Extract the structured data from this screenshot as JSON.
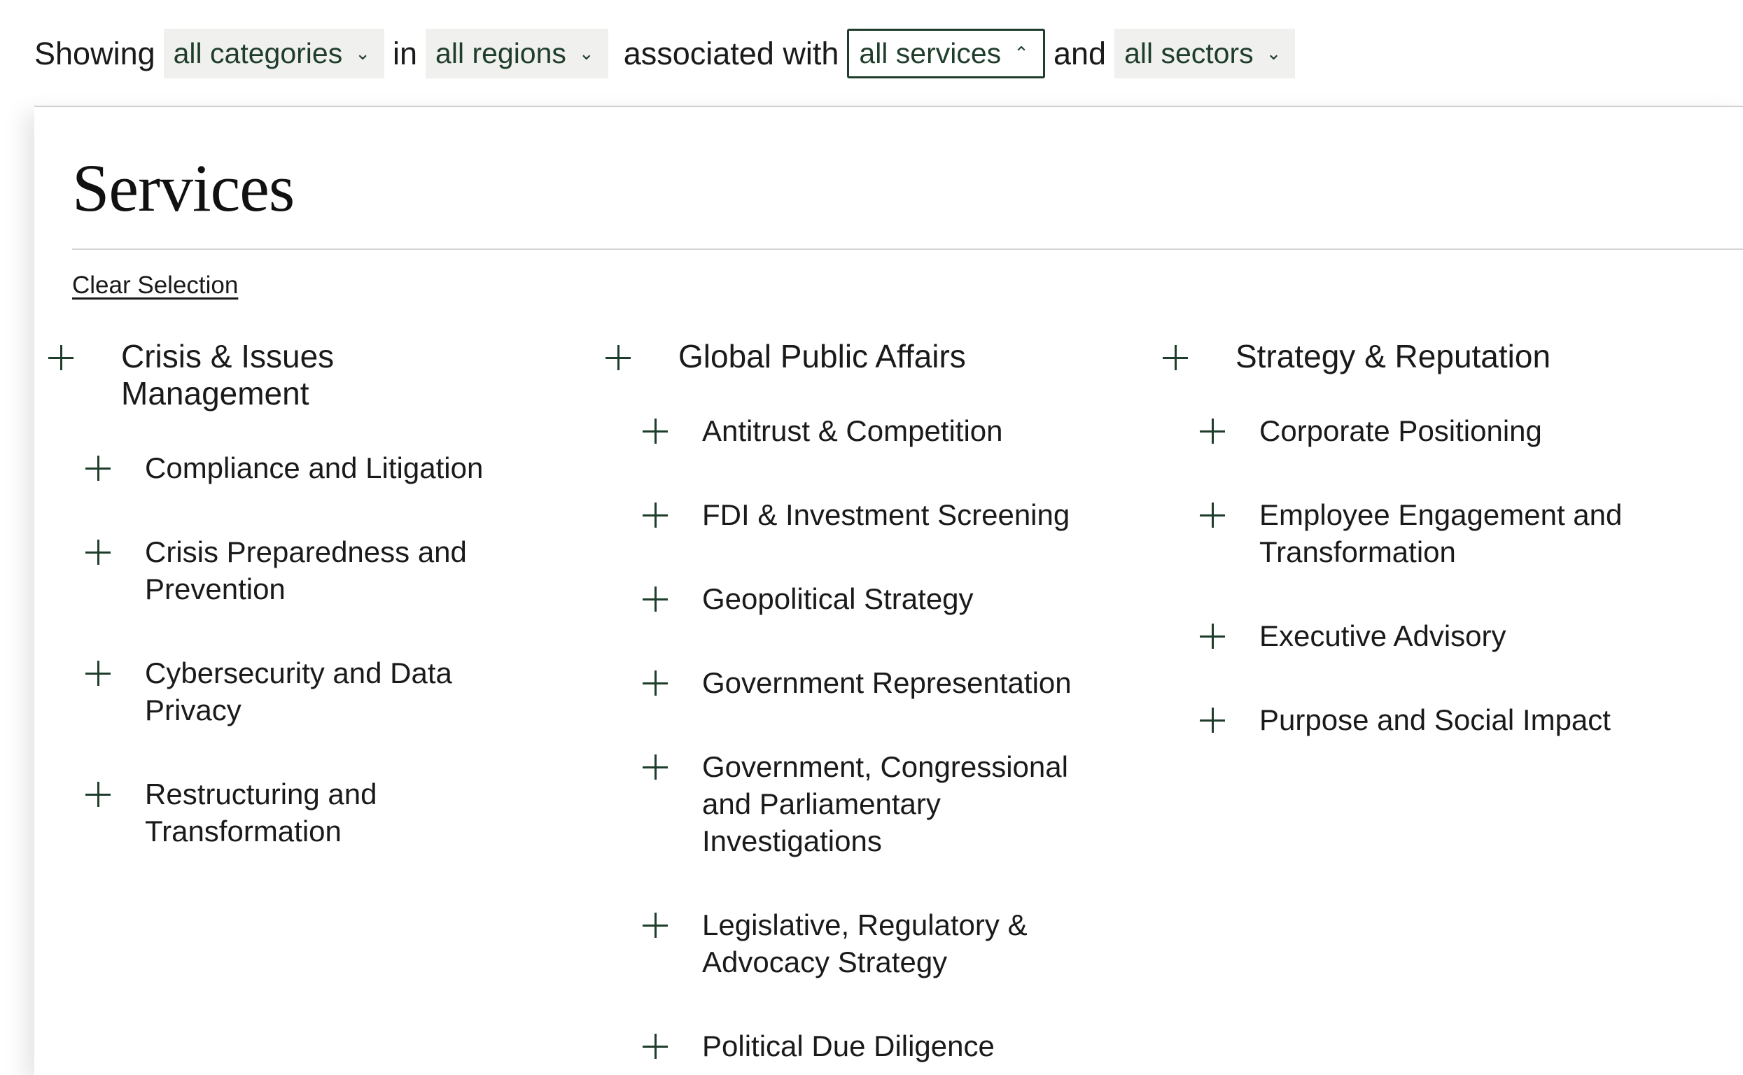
{
  "filter_bar": {
    "showing": "Showing",
    "categories": "all categories",
    "in": "in",
    "regions": "all regions",
    "associated_with": "associated with",
    "services": "all services",
    "and": "and",
    "sectors": "all sectors"
  },
  "panel": {
    "title": "Services",
    "clear_label": "Clear Selection",
    "columns": [
      {
        "parent": "Crisis & Issues Management",
        "children": [
          "Compliance and Litigation",
          "Crisis Preparedness and Prevention",
          "Cybersecurity and Data Privacy",
          "Restructuring and Transformation"
        ]
      },
      {
        "parent": "Global Public Affairs",
        "children": [
          "Antitrust & Competition",
          "FDI & Investment Screening",
          "Geopolitical Strategy",
          "Government Representation",
          "Government, Congressional and Parliamentary Investigations",
          "Legislative, Regulatory & Advocacy Strategy",
          "Political Due Diligence"
        ]
      },
      {
        "parent": "Strategy & Reputation",
        "children": [
          "Corporate Positioning",
          "Employee Engagement and Transformation",
          "Executive Advisory",
          "Purpose and Social Impact"
        ]
      }
    ]
  },
  "colors": {
    "accent": "#1f3d2b",
    "pill_bg": "#f0f0ee",
    "text": "#1a1a1a"
  }
}
